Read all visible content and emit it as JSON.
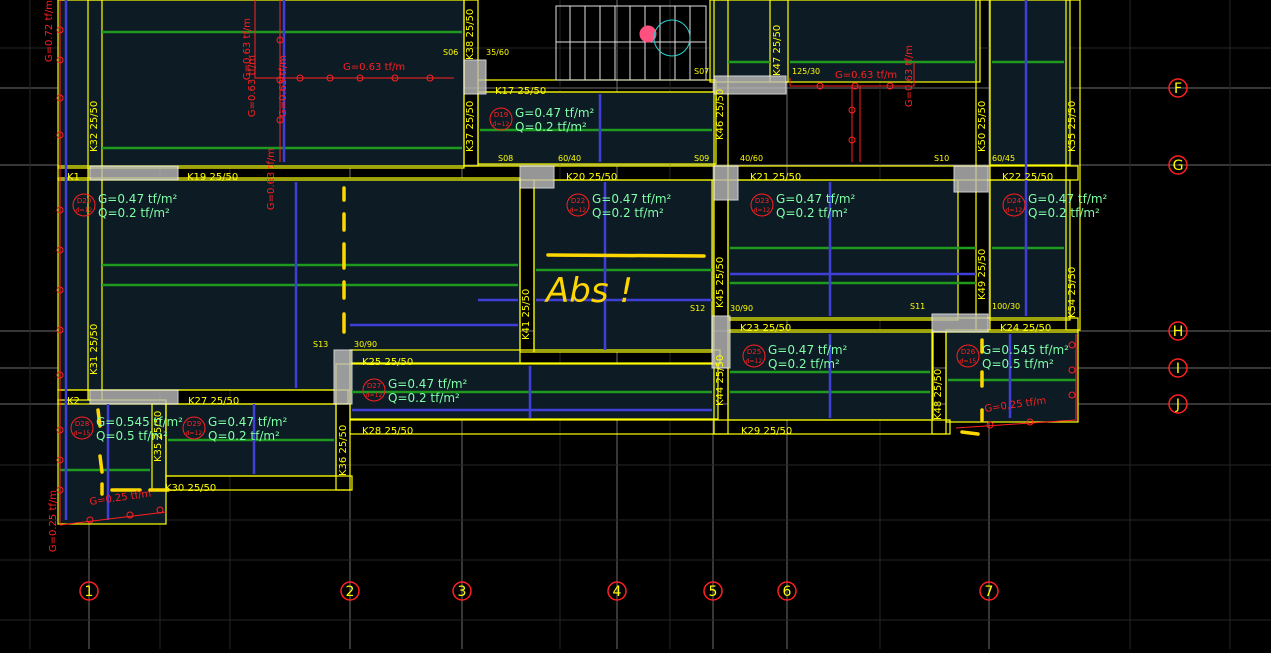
{
  "colors": {
    "background": "#000000",
    "slab_fill": "#0d1b24",
    "beam_outline": "#ffff00",
    "grid": "#6e6e6e",
    "load_red": "#ff2020",
    "rebar_green": "#1f9a1f",
    "rebar_blue": "#3f3fd8",
    "slab_label": "#7fffa8",
    "axis_bubble": "#ff2020",
    "axis_text": "#ffff00",
    "annotation": "#ffd700"
  },
  "axes_vertical": [
    {
      "label": "1"
    },
    {
      "label": "2"
    },
    {
      "label": "3"
    },
    {
      "label": "4"
    },
    {
      "label": "5"
    },
    {
      "label": "6"
    },
    {
      "label": "7"
    }
  ],
  "axes_horizontal": [
    {
      "label": "F"
    },
    {
      "label": "G"
    },
    {
      "label": "H"
    },
    {
      "label": "I"
    },
    {
      "label": "J"
    }
  ],
  "beams": [
    {
      "name": "K17",
      "size": "25/50"
    },
    {
      "name": "K19",
      "size": "25/50"
    },
    {
      "name": "K20",
      "size": "25/50"
    },
    {
      "name": "K21",
      "size": "25/50"
    },
    {
      "name": "K22",
      "size": "25/50"
    },
    {
      "name": "K23",
      "size": "25/50"
    },
    {
      "name": "K24",
      "size": "25/50"
    },
    {
      "name": "K25",
      "size": "25/50"
    },
    {
      "name": "K27",
      "size": "25/50"
    },
    {
      "name": "K28",
      "size": "25/50"
    },
    {
      "name": "K29",
      "size": "25/50"
    },
    {
      "name": "K30",
      "size": "25/50"
    },
    {
      "name": "K1",
      "size": ""
    },
    {
      "name": "K2",
      "size": ""
    }
  ],
  "vbeams": [
    {
      "name": "K32",
      "size": "25/50"
    },
    {
      "name": "K31",
      "size": "25/50"
    },
    {
      "name": "K37",
      "size": "25/50"
    },
    {
      "name": "K38",
      "size": "25/50"
    },
    {
      "name": "K46",
      "size": "25/50"
    },
    {
      "name": "K45",
      "size": "25/50"
    },
    {
      "name": "K44",
      "size": "25/50"
    },
    {
      "name": "K41",
      "size": "25/50"
    },
    {
      "name": "K36",
      "size": "25/50"
    },
    {
      "name": "K35",
      "size": "25/50"
    },
    {
      "name": "K50",
      "size": "25/50"
    },
    {
      "name": "K49",
      "size": "25/50"
    },
    {
      "name": "K48",
      "size": "25/50"
    },
    {
      "name": "K55",
      "size": "25/50"
    },
    {
      "name": "K54",
      "size": "25/50"
    },
    {
      "name": "K47",
      "size": "25/50"
    }
  ],
  "columns": [
    {
      "name": "S06",
      "size": "35/60"
    },
    {
      "name": "S07",
      "size": "125/30"
    },
    {
      "name": "S08",
      "size": "60/40"
    },
    {
      "name": "S09",
      "size": "40/60"
    },
    {
      "name": "S10",
      "size": "60/45"
    },
    {
      "name": "S11",
      "size": "100/30"
    },
    {
      "name": "S12",
      "size": "30/90"
    },
    {
      "name": "S13",
      "size": "30/90"
    }
  ],
  "slabs": [
    {
      "id": "D19",
      "d": "d=12",
      "g": "G=0.47 tf/m²",
      "q": "Q=0.2 tf/m²"
    },
    {
      "id": "D20",
      "d": "d=12",
      "g": "G=0.47 tf/m²",
      "q": "Q=0.2 tf/m²"
    },
    {
      "id": "D22",
      "d": "d=12",
      "g": "G=0.47 tf/m²",
      "q": "Q=0.2 tf/m²"
    },
    {
      "id": "D23",
      "d": "d=12",
      "g": "G=0.47 tf/m²",
      "q": "Q=0.2 tf/m²"
    },
    {
      "id": "D24",
      "d": "d=12",
      "g": "G=0.47 tf/m²",
      "q": "Q=0.2 tf/m²"
    },
    {
      "id": "D25",
      "d": "d=12",
      "g": "G=0.47 tf/m²",
      "q": "Q=0.2 tf/m²"
    },
    {
      "id": "D26",
      "d": "d=15",
      "g": "G=0.545 tf/m²",
      "q": "Q=0.5 tf/m²"
    },
    {
      "id": "D27",
      "d": "d=12",
      "g": "G=0.47 tf/m²",
      "q": "Q=0.2 tf/m²"
    },
    {
      "id": "D28",
      "d": "d=15",
      "g": "G=0.545 tf/m²",
      "q": "Q=0.5 tf/m²"
    },
    {
      "id": "D29",
      "d": "d=12",
      "g": "G=0.47 tf/m²",
      "q": "Q=0.2 tf/m²"
    }
  ],
  "line_loads": [
    {
      "text": "G=0.72 tf/m"
    },
    {
      "text": "G=0.63 tf/m"
    },
    {
      "text": "G=0.63 tf/m"
    },
    {
      "text": "G=0.63 tf/m"
    },
    {
      "text": "G=0.63 tf/m"
    },
    {
      "text": "G=0.63 tf/m"
    },
    {
      "text": "G=0.63 tf/m"
    },
    {
      "text": "G=0.63 tf/m"
    },
    {
      "text": "G=0.25 tf/m"
    },
    {
      "text": "G=0.25 tf/m"
    },
    {
      "text": "G=0.25 tf/m"
    }
  ],
  "annotation": {
    "text": "Abs !"
  }
}
